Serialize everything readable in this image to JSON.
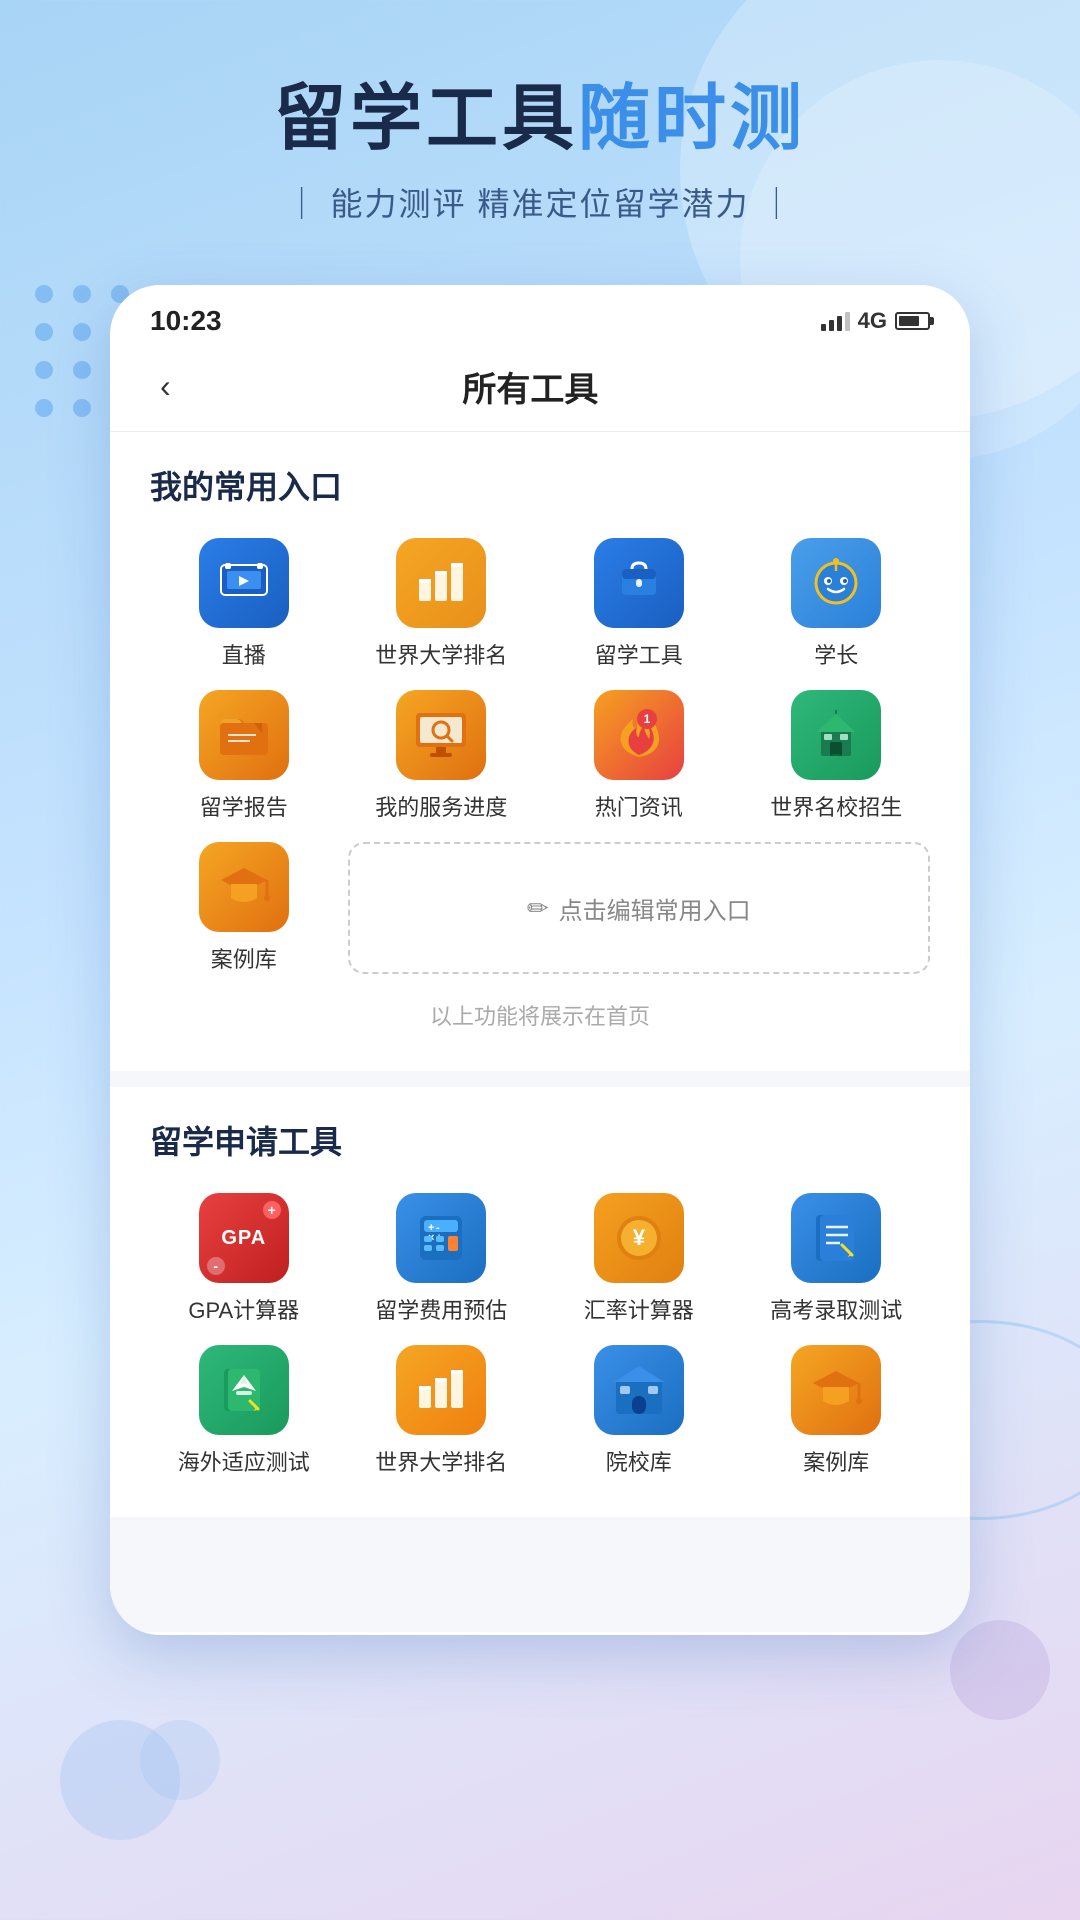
{
  "header": {
    "title_part1": "留学工具",
    "title_part2": "随时测",
    "subtitle": "｜ 能力测评  精准定位留学潜力 ｜"
  },
  "status_bar": {
    "time": "10:23",
    "network": "4G"
  },
  "nav": {
    "back_label": "‹",
    "title": "所有工具"
  },
  "frequent_section": {
    "title": "我的常用入口",
    "items": [
      {
        "label": "直播",
        "icon_type": "live",
        "color": "blue"
      },
      {
        "label": "世界大学排名",
        "icon_type": "ranking",
        "color": "orange"
      },
      {
        "label": "留学工具",
        "icon_type": "tools",
        "color": "blue"
      },
      {
        "label": "学长",
        "icon_type": "robot",
        "color": "blue"
      },
      {
        "label": "留学报告",
        "icon_type": "folder",
        "color": "orange"
      },
      {
        "label": "我的服务进度",
        "icon_type": "monitor",
        "color": "orange"
      },
      {
        "label": "热门资讯",
        "icon_type": "fire",
        "color": "fire"
      },
      {
        "label": "世界名校招生",
        "icon_type": "school",
        "color": "green"
      },
      {
        "label": "案例库",
        "icon_type": "grad",
        "color": "orange"
      }
    ],
    "edit_label": "点击编辑常用入口",
    "footer_hint": "以上功能将展示在首页"
  },
  "study_section": {
    "title": "留学申请工具",
    "items": [
      {
        "label": "GPA计算器",
        "icon_type": "gpa",
        "color": "red"
      },
      {
        "label": "留学费用预估",
        "icon_type": "calc",
        "color": "blue"
      },
      {
        "label": "汇率计算器",
        "icon_type": "currency",
        "color": "orange"
      },
      {
        "label": "高考录取测试",
        "icon_type": "notebook",
        "color": "blue"
      },
      {
        "label": "海外适应测试",
        "icon_type": "plane",
        "color": "green"
      },
      {
        "label": "世界大学排名",
        "icon_type": "ranking2",
        "color": "orange"
      },
      {
        "label": "院校库",
        "icon_type": "school2",
        "color": "blue"
      },
      {
        "label": "案例库",
        "icon_type": "grad2",
        "color": "orange"
      }
    ]
  }
}
